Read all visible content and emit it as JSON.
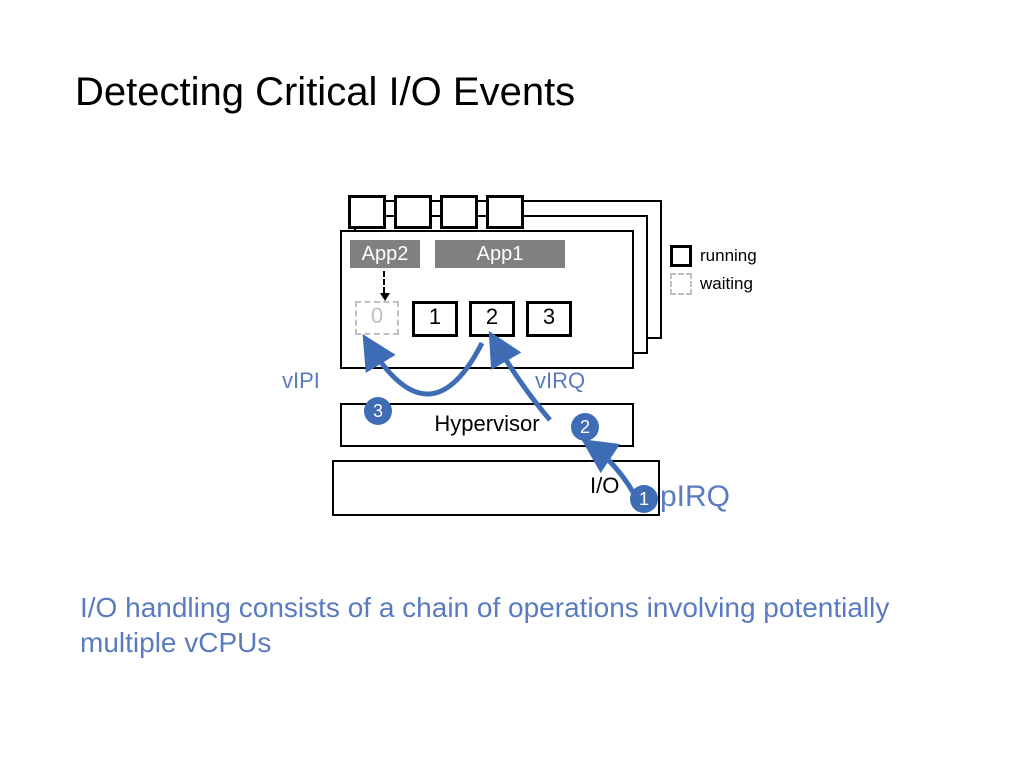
{
  "title": "Detecting Critical I/O Events",
  "caption": "I/O handling consists of a chain of operations involving potentially multiple vCPUs",
  "apps": {
    "app2": "App2",
    "app1": "App1"
  },
  "vcpus": [
    "0",
    "1",
    "2",
    "3"
  ],
  "vcpu_state": [
    "waiting",
    "running",
    "running",
    "running"
  ],
  "hypervisor": "Hypervisor",
  "io_label": "I/O",
  "legend": {
    "running": "running",
    "waiting": "waiting"
  },
  "labels": {
    "vIPI": "vIPI",
    "vIRQ": "vIRQ",
    "pIRQ": "pIRQ"
  },
  "badges": {
    "b1": "1",
    "b2": "2",
    "b3": "3"
  },
  "colors": {
    "accent_blue": "#5a7bbf",
    "badge_blue": "#3e6db5",
    "app_gray": "#808080",
    "wait_gray": "#bfbfbf"
  }
}
